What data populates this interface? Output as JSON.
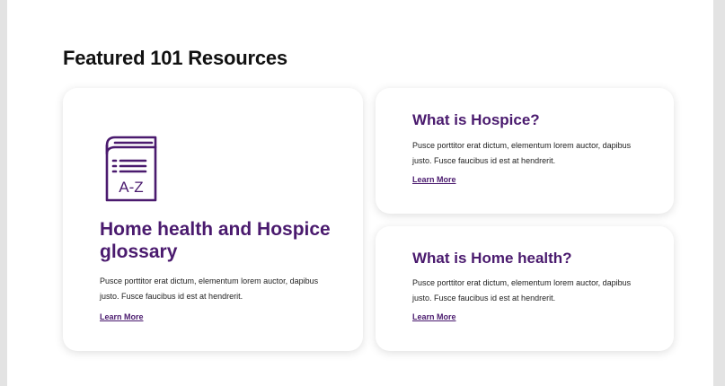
{
  "section": {
    "title": "Featured 101 Resources"
  },
  "featured_card": {
    "icon": "glossary-book-icon",
    "icon_text": "A-Z",
    "title": "Home health and Hospice glossary",
    "body": "Pusce porttitor erat dictum, elementum lorem auctor, dapibus justo. Fusce faucibus id est at hendrerit.",
    "link_label": "Learn More"
  },
  "cards": [
    {
      "title": "What is Hospice?",
      "body": "Pusce porttitor erat dictum, elementum lorem auctor, dapibus justo. Fusce faucibus id est at hendrerit.",
      "link_label": "Learn More"
    },
    {
      "title": "What is Home health?",
      "body": "Pusce porttitor erat dictum, elementum lorem auctor, dapibus justo. Fusce faucibus id est at hendrerit.",
      "link_label": "Learn More"
    }
  ],
  "colors": {
    "brand_purple": "#4a1a6e",
    "page_background": "#e3e3e3",
    "surface": "#ffffff",
    "heading_text": "#111111"
  }
}
